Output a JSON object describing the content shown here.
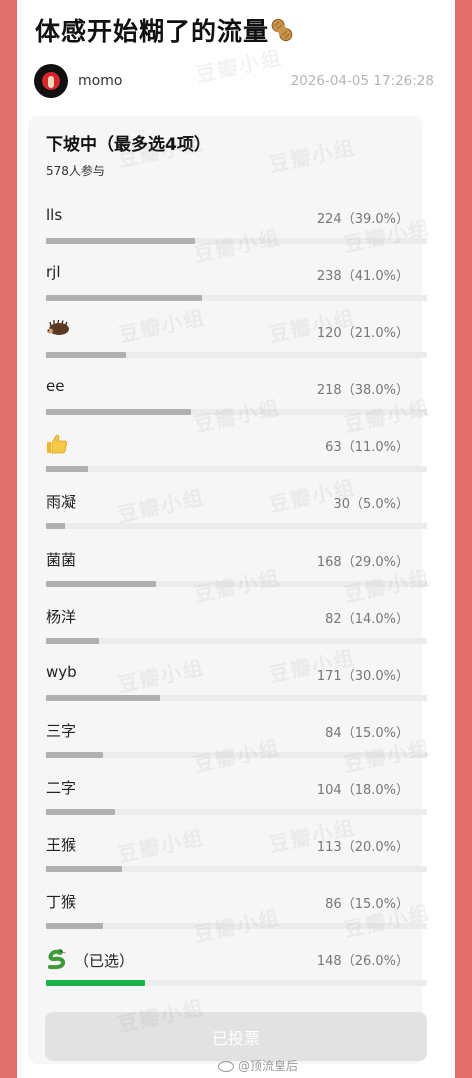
{
  "post": {
    "title": "体感开始糊了的流量",
    "title_icon": "peanut-icon",
    "author": "momo",
    "timestamp": "2026-04-05 17:26:28"
  },
  "poll": {
    "title": "下坡中（最多选4项）",
    "participants": "578人参与",
    "options": [
      {
        "label": "lls",
        "count": "224（39.0%）",
        "percent": 39.0
      },
      {
        "label": "rjl",
        "count": "238（41.0%）",
        "percent": 41.0
      },
      {
        "label": "",
        "icon": "hedgehog-icon",
        "count": "120（21.0%）",
        "percent": 21.0
      },
      {
        "label": "ee",
        "count": "218（38.0%）",
        "percent": 38.0
      },
      {
        "label": "",
        "icon": "thumbs-up-icon",
        "count": "63（11.0%）",
        "percent": 11.0
      },
      {
        "label": "雨凝",
        "count": "30（5.0%）",
        "percent": 5.0
      },
      {
        "label": "菌菌",
        "count": "168（29.0%）",
        "percent": 29.0
      },
      {
        "label": "杨洋",
        "count": "82（14.0%）",
        "percent": 14.0
      },
      {
        "label": "wyb",
        "count": "171（30.0%）",
        "percent": 30.0
      },
      {
        "label": "三字",
        "count": "84（15.0%）",
        "percent": 15.0
      },
      {
        "label": "二字",
        "count": "104（18.0%）",
        "percent": 18.0
      },
      {
        "label": "王猴",
        "count": "113（20.0%）",
        "percent": 20.0
      },
      {
        "label": "丁猴",
        "count": "86（15.0%）",
        "percent": 15.0
      },
      {
        "label": "（已选）",
        "icon": "snake-icon",
        "count": "148（26.0%）",
        "percent": 26.0,
        "selected": true
      }
    ],
    "button_label": "已投票"
  },
  "watermark": "豆瓣小组",
  "source_mark": "@顶流皇后",
  "colors": {
    "background": "#e36f6c",
    "selected_bar": "#1ab24a",
    "bar": "#b0b0b0"
  }
}
